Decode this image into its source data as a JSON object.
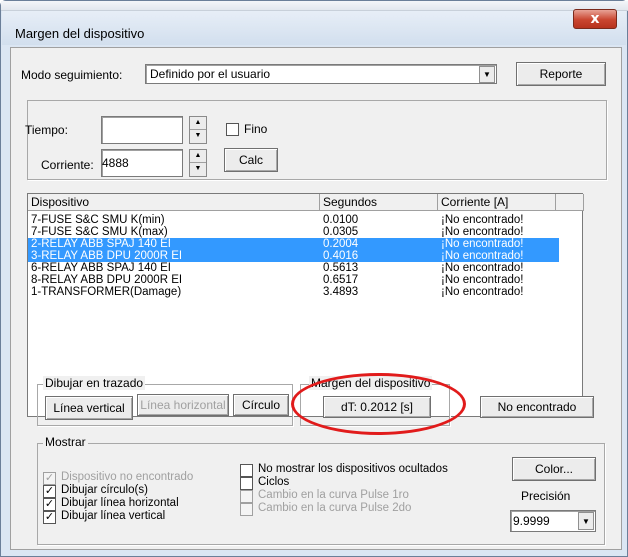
{
  "window": {
    "title": "Margen del dispositivo",
    "close_glyph": "x"
  },
  "tracking": {
    "label": "Modo seguimiento:",
    "value": "Definido por el usuario",
    "report_button": "Reporte"
  },
  "inputs": {
    "time_label": "Tiempo:",
    "time_value": "",
    "fine_label": "Fino",
    "current_label": "Corriente:",
    "current_value": "4888",
    "calc_button": "Calc"
  },
  "device_list": {
    "columns": [
      "Dispositivo",
      "Segundos",
      "Corriente [A]"
    ],
    "rows": [
      {
        "device": "7-FUSE S&C SMU K(min)",
        "seconds": "0.0100",
        "current": "¡No encontrado!",
        "selected": false
      },
      {
        "device": "7-FUSE S&C SMU K(max)",
        "seconds": "0.0305",
        "current": "¡No encontrado!",
        "selected": false
      },
      {
        "device": "2-RELAY ABB SPAJ 140 EI",
        "seconds": "0.2004",
        "current": "¡No encontrado!",
        "selected": true
      },
      {
        "device": "3-RELAY ABB DPU 2000R EI",
        "seconds": "0.4016",
        "current": "¡No encontrado!",
        "selected": true
      },
      {
        "device": "6-RELAY ABB SPAJ 140 EI",
        "seconds": "0.5613",
        "current": "¡No encontrado!",
        "selected": false
      },
      {
        "device": "8-RELAY ABB DPU 2000R EI",
        "seconds": "0.6517",
        "current": "¡No encontrado!",
        "selected": false
      },
      {
        "device": "1-TRANSFORMER(Damage)",
        "seconds": "3.4893",
        "current": "¡No encontrado!",
        "selected": false
      }
    ]
  },
  "draw_group": {
    "title": "Dibujar en trazado",
    "vertical_line_button": "Línea vertical",
    "horizontal_line_button": "Línea horizontal",
    "circle_button": "Círculo"
  },
  "margin_group": {
    "title": "Margen del dispositivo",
    "dt_button": "dT: 0.2012 [s]"
  },
  "not_found_button": "No encontrado",
  "show_group": {
    "title": "Mostrar",
    "options_left": [
      {
        "label": "Dispositivo no encontrado",
        "checked": true,
        "disabled": true
      },
      {
        "label": "Dibujar círculo(s)",
        "checked": true,
        "disabled": false
      },
      {
        "label": "Dibujar línea horizontal",
        "checked": true,
        "disabled": false
      },
      {
        "label": "Dibujar línea vertical",
        "checked": true,
        "disabled": false
      }
    ],
    "options_right": [
      {
        "label": "No mostrar los dispositivos ocultados",
        "checked": false,
        "disabled": false
      },
      {
        "label": "Ciclos",
        "checked": false,
        "disabled": false
      },
      {
        "label": "Cambio en la curva Pulse 1ro",
        "checked": false,
        "disabled": true
      },
      {
        "label": "Cambio en la curva Pulse 2do",
        "checked": false,
        "disabled": true
      }
    ],
    "color_button": "Color...",
    "precision_label": "Precisión",
    "precision_value": "9.9999"
  },
  "colors": {
    "selection": "#3399ff",
    "highlight_ring": "#e11b1b",
    "close_button": "#c9452f"
  }
}
